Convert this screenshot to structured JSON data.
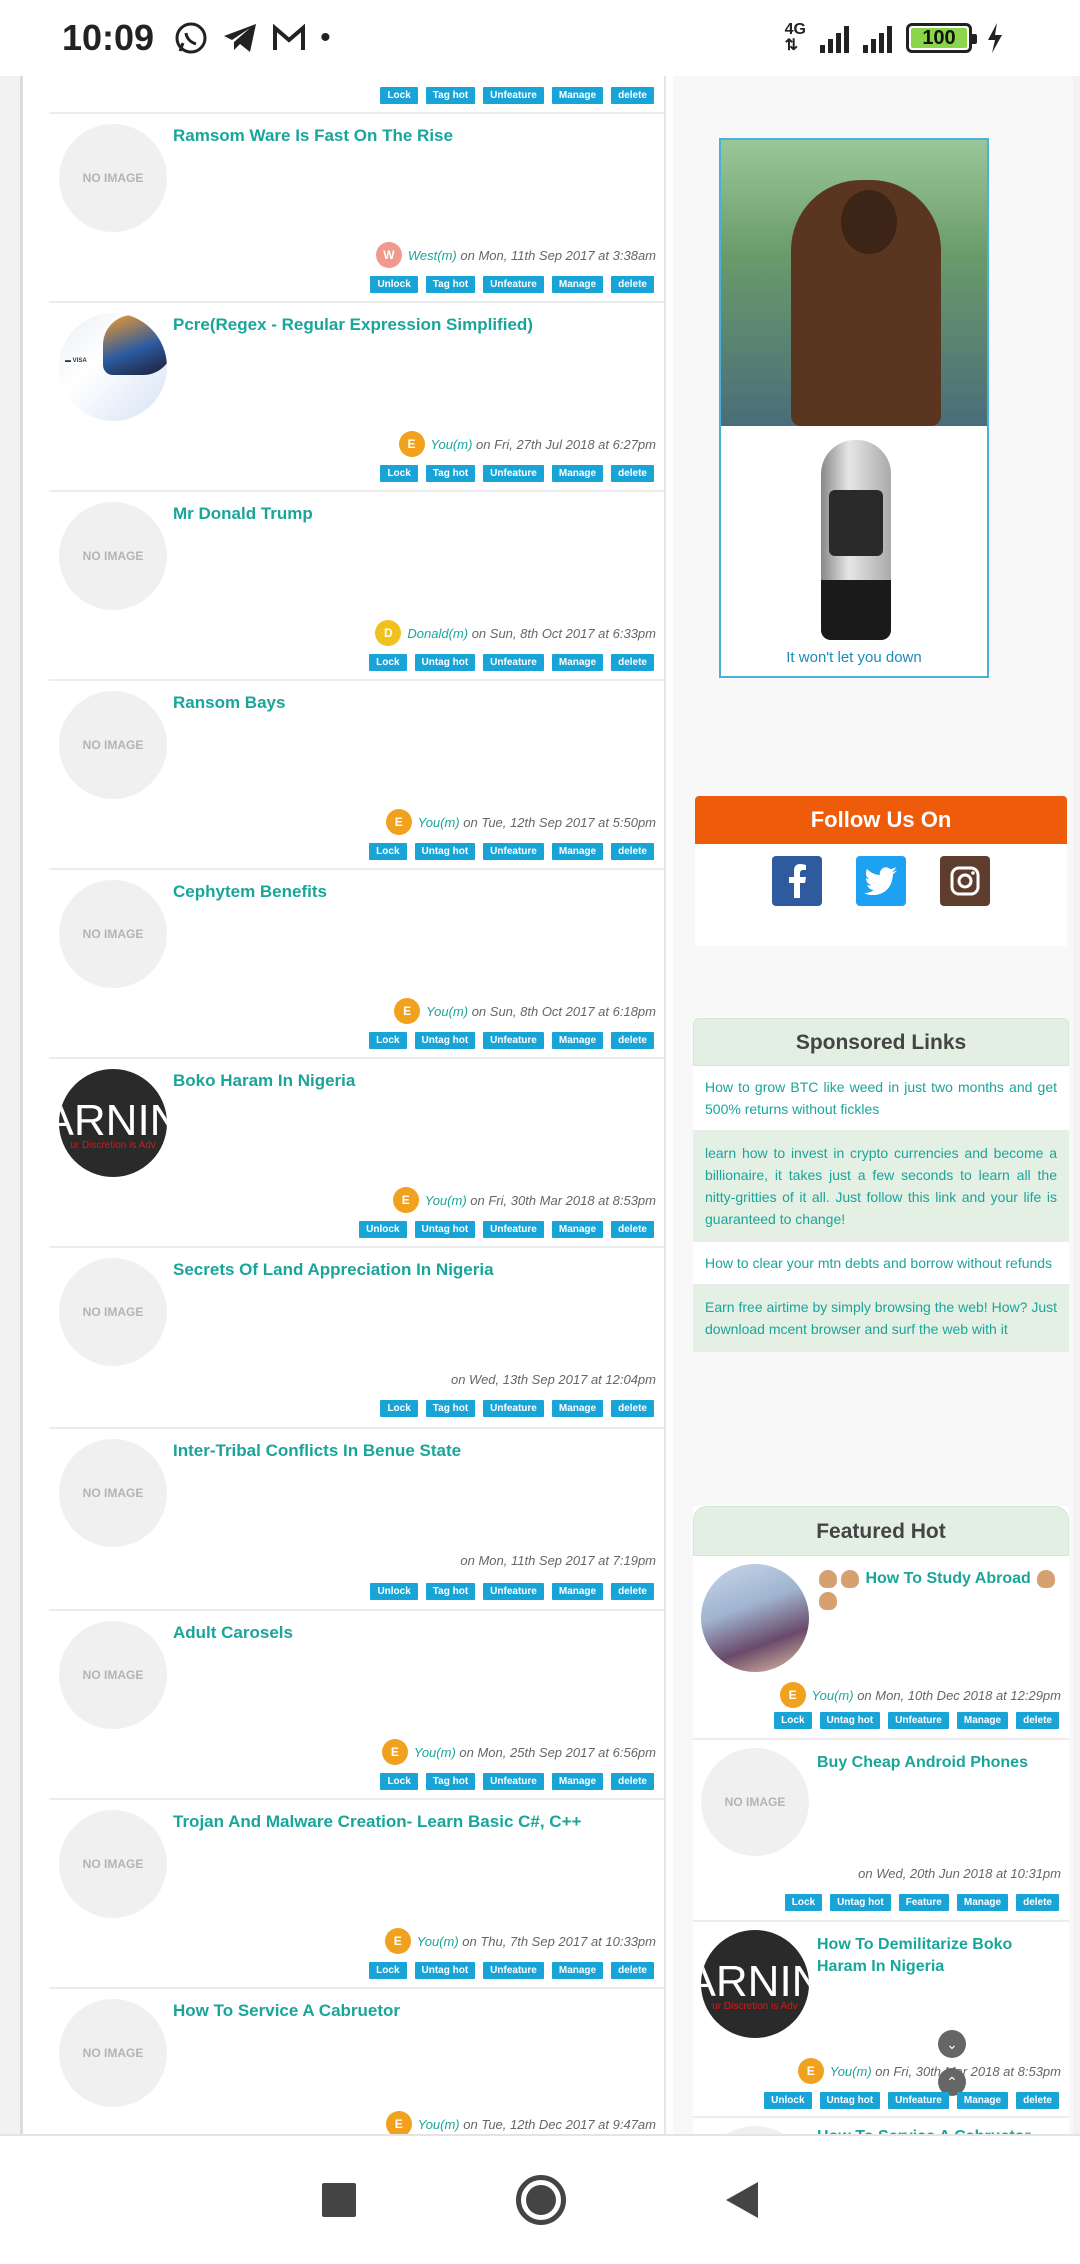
{
  "status_bar": {
    "time": "10:09",
    "network": "4G",
    "battery": "100",
    "icons": [
      "whatsapp-icon",
      "telegram-icon",
      "gmail-icon"
    ]
  },
  "actions": {
    "lock": "Lock",
    "unlock": "Unlock",
    "tag_hot": "Tag hot",
    "untag_hot": "Untag hot",
    "unfeature": "Unfeature",
    "feature": "Feature",
    "manage": "Manage",
    "delete": "delete"
  },
  "topics": [
    {
      "title": "Ramsom Ware Is Fast On The Rise",
      "thumb": "NO IMAGE",
      "avatar": "W",
      "user": "West(m)",
      "date": "on Mon, 11th Sep 2017 at 3:38am",
      "lock": "Unlock",
      "hot": "Tag hot"
    },
    {
      "title": "Pcre(Regex - Regular Expression Simplified)",
      "thumb": "",
      "avatar": "E",
      "user": "You(m)",
      "date": "on Fri, 27th Jul 2018 at 6:27pm",
      "lock": "Lock",
      "hot": "Tag hot"
    },
    {
      "title": "Mr Donald Trump",
      "thumb": "NO IMAGE",
      "avatar": "D",
      "user": "Donald(m)",
      "date": "on Sun, 8th Oct 2017 at 6:33pm",
      "lock": "Lock",
      "hot": "Untag hot"
    },
    {
      "title": "Ransom Bays",
      "thumb": "NO IMAGE",
      "avatar": "E",
      "user": "You(m)",
      "date": "on Tue, 12th Sep 2017 at 5:50pm",
      "lock": "Lock",
      "hot": "Untag hot"
    },
    {
      "title": "Cephytem Benefits",
      "thumb": "NO IMAGE",
      "avatar": "E",
      "user": "You(m)",
      "date": "on Sun, 8th Oct 2017 at 6:18pm",
      "lock": "Lock",
      "hot": "Untag hot"
    },
    {
      "title": "Boko Haram In Nigeria",
      "thumb": "ARNIN",
      "avatar": "E",
      "user": "You(m)",
      "date": "on Fri, 30th Mar 2018 at 8:53pm",
      "lock": "Unlock",
      "hot": "Untag hot"
    },
    {
      "title": "Secrets Of Land Appreciation In Nigeria",
      "thumb": "NO IMAGE",
      "avatar": "",
      "user": "",
      "date": "on Wed, 13th Sep 2017 at 12:04pm",
      "lock": "Lock",
      "hot": "Tag hot"
    },
    {
      "title": "Inter-Tribal Conflicts In Benue State",
      "thumb": "NO IMAGE",
      "avatar": "",
      "user": "",
      "date": "on Mon, 11th Sep 2017 at 7:19pm",
      "lock": "Unlock",
      "hot": "Tag hot"
    },
    {
      "title": "Adult Carosels",
      "thumb": "NO IMAGE",
      "avatar": "E",
      "user": "You(m)",
      "date": "on Mon, 25th Sep 2017 at 6:56pm",
      "lock": "Lock",
      "hot": "Tag hot"
    },
    {
      "title": "Trojan And Malware Creation- Learn Basic C#, C++",
      "thumb": "NO IMAGE",
      "avatar": "E",
      "user": "You(m)",
      "date": "on Thu, 7th Sep 2017 at 10:33pm",
      "lock": "Lock",
      "hot": "Untag hot"
    },
    {
      "title": "How To Service A Cabruetor",
      "thumb": "NO IMAGE",
      "avatar": "E",
      "user": "You(m)",
      "date": "on Tue, 12th Dec 2017 at 9:47am"
    }
  ],
  "ad": {
    "tagline": "It won't let you down"
  },
  "follow": {
    "heading": "Follow Us On",
    "networks": [
      "f",
      "t",
      "ig"
    ]
  },
  "sponsored": {
    "heading": "Sponsored Links",
    "links": [
      "How to grow BTC like weed in just two months and get 500% returns without fickles",
      "learn how to invest in crypto currencies and become a billionaire, it takes just a few seconds to learn all the nitty-gritties of it all. Just follow this link and your life is guaranteed to change!",
      "How to clear your mtn debts and borrow without refunds",
      "Earn free airtime by simply browsing the web! How? Just download mcent browser and surf the web with it"
    ]
  },
  "featured": {
    "heading": "Featured Hot",
    "items": [
      {
        "title": "How To Study Abroad",
        "thumb": "",
        "avatar": "E",
        "user": "You(m)",
        "date": "on Mon, 10th Dec 2018 at 12:29pm",
        "lock": "Lock",
        "hot": "Untag hot",
        "feature": "Unfeature"
      },
      {
        "title": "Buy Cheap Android Phones",
        "thumb": "NO IMAGE",
        "avatar": "",
        "user": "",
        "date": "on Wed, 20th Jun 2018 at 10:31pm",
        "lock": "Lock",
        "hot": "Untag hot",
        "feature": "Feature"
      },
      {
        "title": "How To Demilitarize Boko Haram In Nigeria",
        "thumb": "ARNIN",
        "avatar": "E",
        "user": "You(m)",
        "date": "on Fri, 30th Mar 2018 at 8:53pm",
        "lock": "Unlock",
        "hot": "Untag hot",
        "feature": "Unfeature"
      },
      {
        "title": "How To Service A Cabruetor"
      }
    ]
  },
  "thumb_caption": "ur Discretion is Adv"
}
